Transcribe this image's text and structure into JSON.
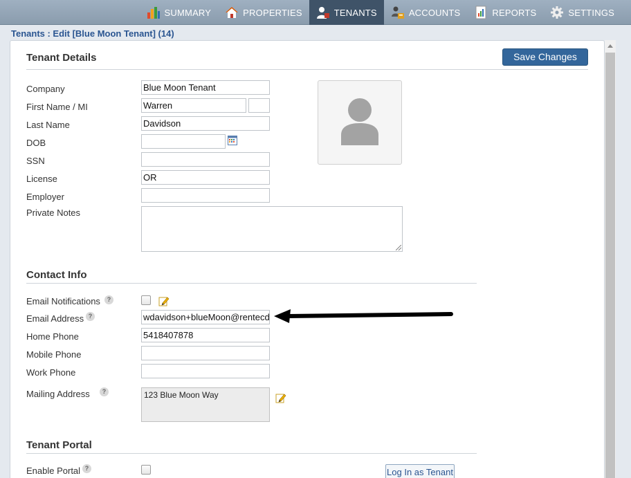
{
  "nav": {
    "items": [
      {
        "label": "SUMMARY",
        "icon": "bar-chart-icon"
      },
      {
        "label": "PROPERTIES",
        "icon": "house-icon"
      },
      {
        "label": "TENANTS",
        "icon": "tenants-icon",
        "active": true
      },
      {
        "label": "ACCOUNTS",
        "icon": "accounts-icon"
      },
      {
        "label": "REPORTS",
        "icon": "reports-icon"
      },
      {
        "label": "SETTINGS",
        "icon": "gear-icon"
      }
    ]
  },
  "breadcrumb": "Tenants : Edit [Blue Moon Tenant] (14)",
  "tenant_details": {
    "title": "Tenant Details",
    "save_label": "Save Changes",
    "company_label": "Company",
    "company_value": "Blue Moon Tenant",
    "first_name_label": "First Name / MI",
    "first_name_value": "Warren",
    "mi_value": "",
    "last_name_label": "Last Name",
    "last_name_value": "Davidson",
    "dob_label": "DOB",
    "dob_value": "",
    "ssn_label": "SSN",
    "ssn_value": "",
    "license_label": "License",
    "license_value": "OR",
    "employer_label": "Employer",
    "employer_value": "",
    "notes_label": "Private Notes",
    "notes_value": ""
  },
  "contact_info": {
    "title": "Contact Info",
    "email_notifications_label": "Email Notifications",
    "email_notifications_checked": false,
    "email_label": "Email Address",
    "email_value": "wdavidson+blueMoon@rentecdirect.com",
    "home_phone_label": "Home Phone",
    "home_phone_value": "5418407878",
    "mobile_phone_label": "Mobile Phone",
    "mobile_phone_value": "",
    "work_phone_label": "Work Phone",
    "work_phone_value": "",
    "mailing_address_label": "Mailing Address",
    "mailing_address_value": "123 Blue Moon Way"
  },
  "tenant_portal": {
    "title": "Tenant Portal",
    "enable_label": "Enable Portal",
    "enable_checked": false,
    "login_label": "Log In as Tenant"
  },
  "help_glyph": "?",
  "colors": {
    "accent": "#33669b",
    "nav_active": "#3f5368",
    "link": "#2a5591"
  }
}
